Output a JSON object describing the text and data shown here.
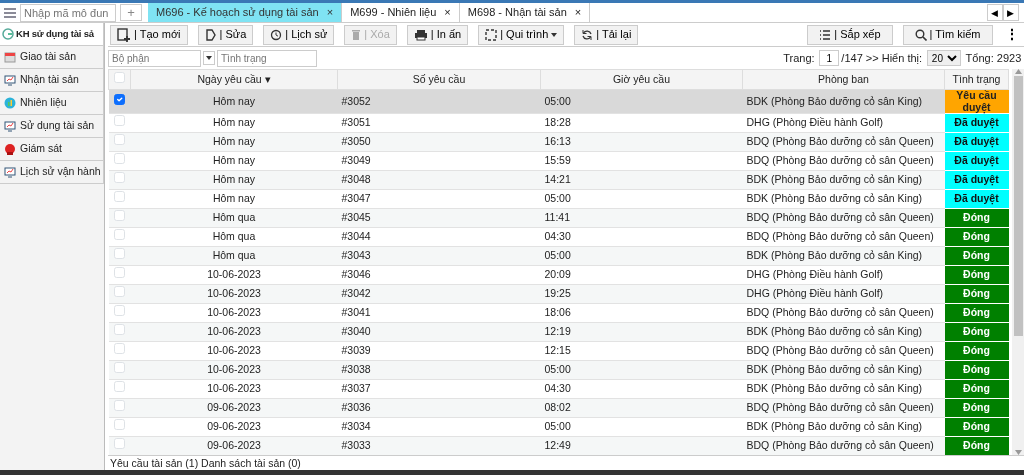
{
  "top_bar": {
    "module_search": {
      "placeholder": "Nhập mã mô đun"
    },
    "add_label": "+",
    "tabs": [
      {
        "label": "M696 - Kế hoạch sử dụng tài sản",
        "selected": true,
        "close": "×"
      },
      {
        "label": "M699 - Nhiên liệu",
        "selected": false,
        "close": "×"
      },
      {
        "label": "M698 - Nhận tài sản",
        "selected": false,
        "close": "×"
      }
    ],
    "scroll_left": "◀",
    "scroll_right": "▶"
  },
  "sidebar": {
    "items": [
      {
        "label": "KH sử dụng tài sả",
        "selected": true
      },
      {
        "label": "Giao tài sản",
        "selected": false
      },
      {
        "label": "Nhận tài sản",
        "selected": false
      },
      {
        "label": "Nhiên liệu",
        "selected": false
      },
      {
        "label": "Sử dụng tài sản",
        "selected": false
      },
      {
        "label": "Giám sát",
        "selected": false
      },
      {
        "label": "Lịch sử vận hành",
        "selected": false
      }
    ]
  },
  "toolbar": {
    "buttons": [
      {
        "label": "| Tạo mới",
        "disabled": false
      },
      {
        "label": "| Sửa",
        "disabled": false
      },
      {
        "label": "| Lịch sử",
        "disabled": false
      },
      {
        "label": "| Xóa",
        "disabled": true
      },
      {
        "label": "| In ấn",
        "disabled": false
      },
      {
        "label": "| Qui trình",
        "disabled": false,
        "dropdown": true
      },
      {
        "label": "| Tải lại",
        "disabled": false
      }
    ],
    "right_buttons": [
      {
        "label": "| Sắp xếp"
      },
      {
        "label": "| Tìm kiếm"
      }
    ],
    "more": "⋮"
  },
  "filters": {
    "department": {
      "placeholder": "Bộ phận"
    },
    "status": {
      "placeholder": "Tình trạng"
    }
  },
  "pagination": {
    "page_label": "Trang:",
    "page": "1",
    "of_pages": "/147 >> Hiển thị:",
    "page_size": "20",
    "total": "Tổng: 2923"
  },
  "table": {
    "all_checked": false,
    "columns": [
      "Ngày yêu cầu",
      "Số yêu cầu",
      "Giờ yêu cầu",
      "Phòng ban",
      "Tình trạng"
    ],
    "sort_mark": "▾",
    "rows": [
      {
        "date": "Hôm nay",
        "number": "#3052",
        "time": "05:00",
        "department": "BDK (Phòng Bảo dưỡng cỏ sân King)",
        "status": "Yêu cầu duyệt",
        "kind": "pending",
        "checked": true,
        "selected": true
      },
      {
        "date": "Hôm nay",
        "number": "#3051",
        "time": "18:28",
        "department": "DHG (Phòng Điều hành Golf)",
        "status": "Đã duyệt",
        "kind": "approved",
        "checked": false,
        "selected": false
      },
      {
        "date": "Hôm nay",
        "number": "#3050",
        "time": "16:13",
        "department": "BDQ (Phòng Bảo dưỡng cỏ sân Queen)",
        "status": "Đã duyệt",
        "kind": "approved",
        "checked": false,
        "selected": false
      },
      {
        "date": "Hôm nay",
        "number": "#3049",
        "time": "15:59",
        "department": "BDQ (Phòng Bảo dưỡng cỏ sân Queen)",
        "status": "Đã duyệt",
        "kind": "approved",
        "checked": false,
        "selected": false
      },
      {
        "date": "Hôm nay",
        "number": "#3048",
        "time": "14:21",
        "department": "BDK (Phòng Bảo dưỡng cỏ sân King)",
        "status": "Đã duyệt",
        "kind": "approved",
        "checked": false,
        "selected": false
      },
      {
        "date": "Hôm nay",
        "number": "#3047",
        "time": "05:00",
        "department": "BDK (Phòng Bảo dưỡng cỏ sân King)",
        "status": "Đã duyệt",
        "kind": "approved",
        "checked": false,
        "selected": false
      },
      {
        "date": "Hôm qua",
        "number": "#3045",
        "time": "11:41",
        "department": "BDQ (Phòng Bảo dưỡng cỏ sân Queen)",
        "status": "Đóng",
        "kind": "closed",
        "checked": false,
        "selected": false
      },
      {
        "date": "Hôm qua",
        "number": "#3044",
        "time": "04:30",
        "department": "BDQ (Phòng Bảo dưỡng cỏ sân Queen)",
        "status": "Đóng",
        "kind": "closed",
        "checked": false,
        "selected": false
      },
      {
        "date": "Hôm qua",
        "number": "#3043",
        "time": "05:00",
        "department": "BDK (Phòng Bảo dưỡng cỏ sân King)",
        "status": "Đóng",
        "kind": "closed",
        "checked": false,
        "selected": false
      },
      {
        "date": "10-06-2023",
        "number": "#3046",
        "time": "20:09",
        "department": "DHG (Phòng Điều hành Golf)",
        "status": "Đóng",
        "kind": "closed",
        "checked": false,
        "selected": false
      },
      {
        "date": "10-06-2023",
        "number": "#3042",
        "time": "19:25",
        "department": "DHG (Phòng Điều hành Golf)",
        "status": "Đóng",
        "kind": "closed",
        "checked": false,
        "selected": false
      },
      {
        "date": "10-06-2023",
        "number": "#3041",
        "time": "18:06",
        "department": "BDQ (Phòng Bảo dưỡng cỏ sân Queen)",
        "status": "Đóng",
        "kind": "closed",
        "checked": false,
        "selected": false
      },
      {
        "date": "10-06-2023",
        "number": "#3040",
        "time": "12:19",
        "department": "BDK (Phòng Bảo dưỡng cỏ sân King)",
        "status": "Đóng",
        "kind": "closed",
        "checked": false,
        "selected": false
      },
      {
        "date": "10-06-2023",
        "number": "#3039",
        "time": "12:15",
        "department": "BDQ (Phòng Bảo dưỡng cỏ sân Queen)",
        "status": "Đóng",
        "kind": "closed",
        "checked": false,
        "selected": false
      },
      {
        "date": "10-06-2023",
        "number": "#3038",
        "time": "05:00",
        "department": "BDK (Phòng Bảo dưỡng cỏ sân King)",
        "status": "Đóng",
        "kind": "closed",
        "checked": false,
        "selected": false
      },
      {
        "date": "10-06-2023",
        "number": "#3037",
        "time": "04:30",
        "department": "BDK (Phòng Bảo dưỡng cỏ sân King)",
        "status": "Đóng",
        "kind": "closed",
        "checked": false,
        "selected": false
      },
      {
        "date": "09-06-2023",
        "number": "#3036",
        "time": "08:02",
        "department": "BDQ (Phòng Bảo dưỡng cỏ sân Queen)",
        "status": "Đóng",
        "kind": "closed",
        "checked": false,
        "selected": false
      },
      {
        "date": "09-06-2023",
        "number": "#3034",
        "time": "05:00",
        "department": "BDK (Phòng Bảo dưỡng cỏ sân King)",
        "status": "Đóng",
        "kind": "closed",
        "checked": false,
        "selected": false
      },
      {
        "date": "09-06-2023",
        "number": "#3033",
        "time": "12:49",
        "department": "BDQ (Phòng Bảo dưỡng cỏ sân Queen)",
        "status": "Đóng",
        "kind": "closed",
        "checked": false,
        "selected": false
      }
    ]
  },
  "footer": "Yêu cầu tài sản (1) Danh sách tài sản (0)"
}
